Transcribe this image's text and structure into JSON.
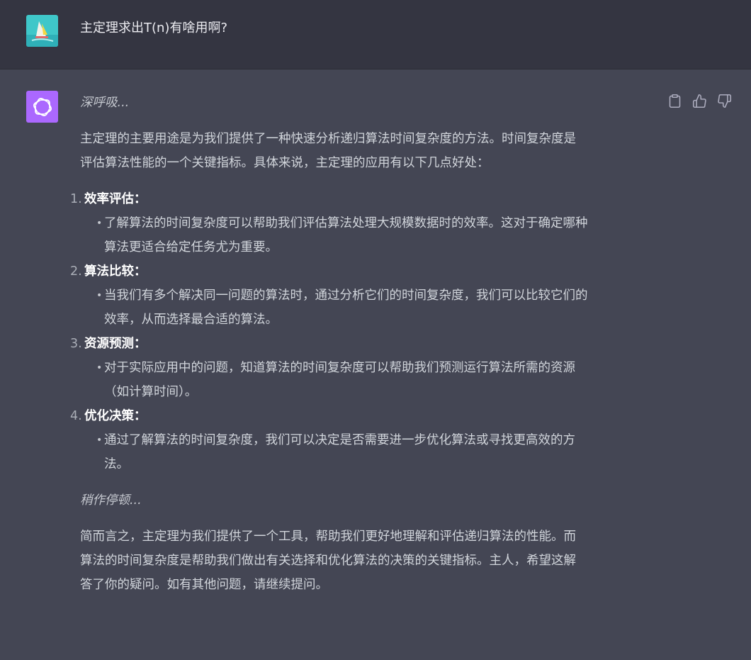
{
  "user": {
    "message": "主定理求出T(n)有啥用啊?"
  },
  "assistant": {
    "intro_italic": "深呼吸...",
    "paragraph1_line1": "主定理的主要用途是为我们提供了一种快速分析递归算法时间复杂度的方法。时间复杂度是",
    "paragraph1_line2": "评估算法性能的一个关键指标。具体来说，主定理的应用有以下几点好处：",
    "items": [
      {
        "number": "1.",
        "title": "效率评估：",
        "bullet_line1": "了解算法的时间复杂度可以帮助我们评估算法处理大规模数据时的效率。这对于确定哪种",
        "bullet_line2": "算法更适合给定任务尤为重要。"
      },
      {
        "number": "2.",
        "title": "算法比较：",
        "bullet_line1": "当我们有多个解决同一问题的算法时，通过分析它们的时间复杂度，我们可以比较它们的",
        "bullet_line2": "效率，从而选择最合适的算法。"
      },
      {
        "number": "3.",
        "title": "资源预测：",
        "bullet_line1": "对于实际应用中的问题，知道算法的时间复杂度可以帮助我们预测运行算法所需的资源",
        "bullet_line2": "（如计算时间）。"
      },
      {
        "number": "4.",
        "title": "优化决策：",
        "bullet_line1": "通过了解算法的时间复杂度，我们可以决定是否需要进一步优化算法或寻找更高效的方",
        "bullet_line2": "法。"
      }
    ],
    "pause_italic": "稍作停顿...",
    "conclusion_line1": "简而言之，主定理为我们提供了一个工具，帮助我们更好地理解和评估递归算法的性能。而",
    "conclusion_line2": "算法的时间复杂度是帮助我们做出有关选择和优化算法的决策的关键指标。主人，希望这解",
    "conclusion_line3": "答了你的疑问。如有其他问题，请继续提问。",
    "bullet_glyph": "•"
  },
  "icons": {
    "copy": "clipboard-icon",
    "like": "thumbs-up-icon",
    "dislike": "thumbs-down-icon"
  },
  "colors": {
    "user_bg": "#343541",
    "assistant_bg": "#444654",
    "assistant_avatar": "#ab68ff"
  }
}
